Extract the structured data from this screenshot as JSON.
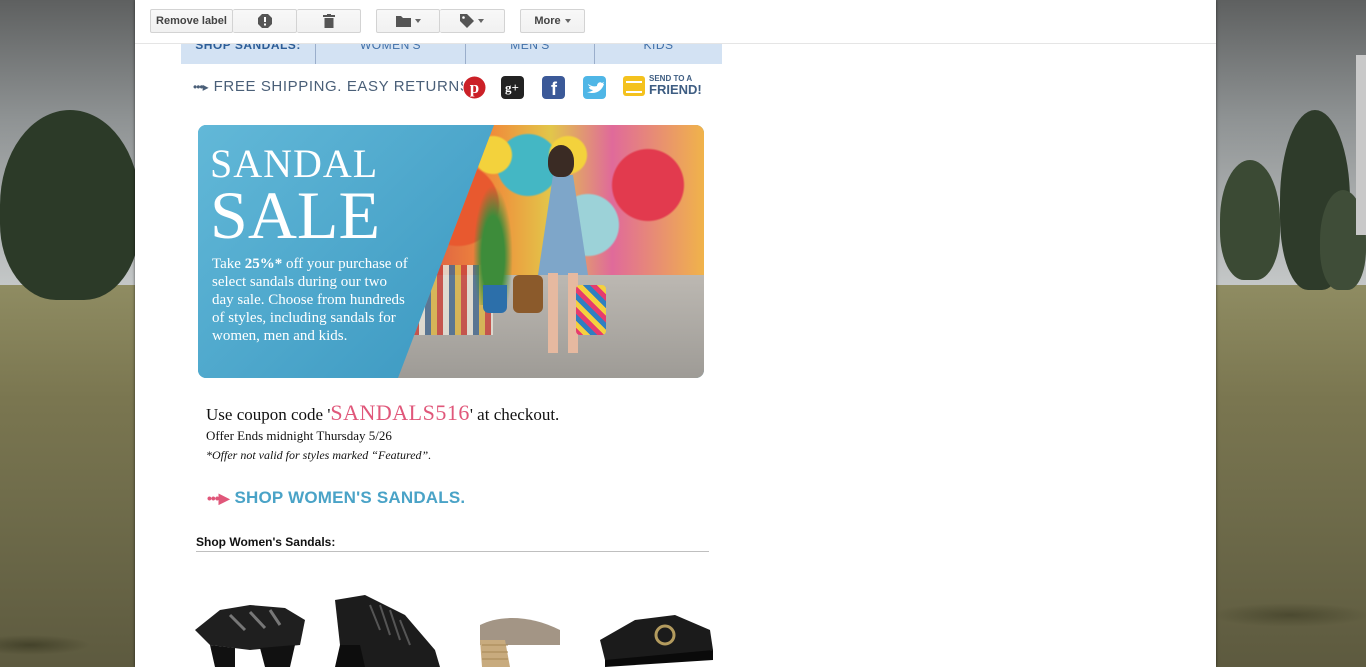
{
  "toolbar": {
    "remove_label": "Remove label",
    "more_label": "More"
  },
  "email": {
    "nav": {
      "items": [
        "SHOP SANDALS:",
        "WOMEN'S",
        "MEN'S",
        "KIDS"
      ]
    },
    "shipping_text": "FREE SHIPPING. EASY RETURNS.",
    "social": [
      "pinterest-icon",
      "google-plus-icon",
      "facebook-icon",
      "twitter-icon"
    ],
    "send_friend": {
      "line1": "SEND TO A",
      "line2": "FRIEND!"
    },
    "banner": {
      "title_line1": "SANDAL",
      "title_line2": "SALE",
      "body_pre": "Take ",
      "body_bold": "25%*",
      "body_post": " off your purchase of select sandals during our two day sale. Choose from hundreds of styles, including sandals for women, men and kids."
    },
    "coupon": {
      "pre": "Use coupon code '",
      "code": "SANDALS516",
      "post": "' at checkout."
    },
    "offer_ends": "Offer Ends midnight Thursday 5/26",
    "not_valid": "*Offer not valid for styles marked “Featured”.",
    "shop_link": "SHOP WOMEN'S SANDALS.",
    "section_heading": "Shop Women's Sandals:"
  },
  "colors": {
    "nav_bg": "#d3e2f3",
    "banner_blue": "#4aa6cc",
    "coupon_pink": "#e0577a",
    "link_blue": "#4aa3c7"
  }
}
